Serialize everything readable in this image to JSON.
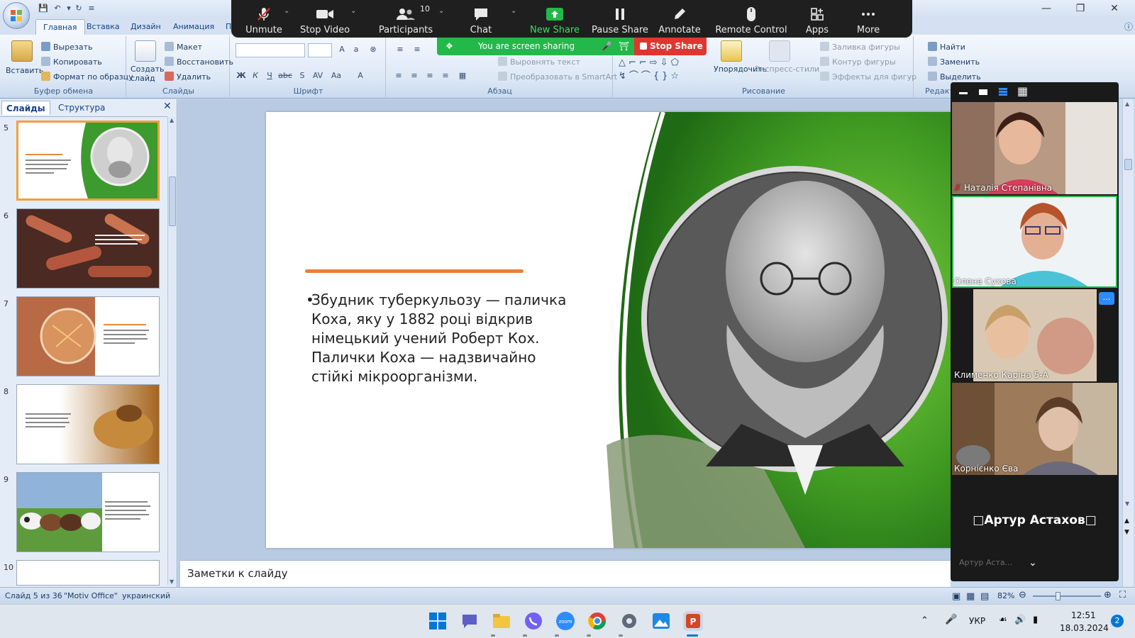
{
  "ribbon": {
    "tabs": [
      "Главная",
      "Вставка",
      "Дизайн",
      "Анимация",
      "П"
    ],
    "clipboard": {
      "paste": "Вставить",
      "cut": "Вырезать",
      "copy": "Копировать",
      "format_painter": "Формат по образцу",
      "group": "Буфер обмена"
    },
    "slides": {
      "create_slide": "Создать слайд",
      "layout": "Макет",
      "reset": "Восстановить",
      "delete": "Удалить",
      "group": "Слайды"
    },
    "font": {
      "group": "Шрифт"
    },
    "paragraph": {
      "align_text": "Выровнять текст",
      "smartart": "Преобразовать в SmartArt",
      "group": "Абзац"
    },
    "drawing": {
      "arrange": "Упорядочить",
      "quick_styles": "Экспресс-стили",
      "shape_fill": "Заливка фигуры",
      "shape_outline": "Контур фигуры",
      "shape_effects": "Эффекты для фигур",
      "group": "Рисование"
    },
    "editing": {
      "find": "Найти",
      "replace": "Заменить",
      "select": "Выделить",
      "group": "Редакт"
    }
  },
  "zoom": {
    "toolbar": [
      {
        "label": "Unmute",
        "icon": "mic-muted-icon"
      },
      {
        "label": "Stop Video",
        "icon": "video-camera-icon"
      },
      {
        "label": "Participants",
        "icon": "participants-icon",
        "count": "10"
      },
      {
        "label": "Chat",
        "icon": "chat-bubble-icon"
      },
      {
        "label": "New Share",
        "icon": "share-screen-icon"
      },
      {
        "label": "Pause Share",
        "icon": "pause-icon"
      },
      {
        "label": "Annotate",
        "icon": "pencil-icon"
      },
      {
        "label": "Remote Control",
        "icon": "mouse-icon"
      },
      {
        "label": "Apps",
        "icon": "apps-icon"
      },
      {
        "label": "More",
        "icon": "more-dots-icon"
      }
    ],
    "banner": "You are screen sharing",
    "stop_share": "Stop Share",
    "participants": [
      {
        "name": "Наталія Степанівна",
        "muted": true
      },
      {
        "name": "Олена Сухова",
        "muted": false
      },
      {
        "name": "Клименко Каріна 5-А",
        "muted": false
      },
      {
        "name": "Корнієнко Єва",
        "muted": false
      }
    ],
    "avatar_only": "□Артур  Астахов□",
    "avatar_only_small": "Артур Аста..."
  },
  "slides_pane": {
    "tab_slides": "Слайды",
    "tab_outline": "Структура",
    "thumbnails": [
      "5",
      "6",
      "7",
      "8",
      "9",
      "10"
    ]
  },
  "slide": {
    "bullet": "Збудник туберкульозу — паличка Коха, яку у 1882 році відкрив німецький учений Роберт Кох. Палички Коха — надзвичайно стійкі мікроорганізми."
  },
  "notes_placeholder": "Заметки к слайду",
  "status": {
    "slide_info": "Слайд 5 из 36",
    "theme": "\"Motiv Office\"",
    "language": "украинский",
    "zoom": "82%"
  },
  "taskbar": {
    "language": "УКР",
    "time": "12:51",
    "date": "18.03.2024",
    "notifications": "2"
  }
}
